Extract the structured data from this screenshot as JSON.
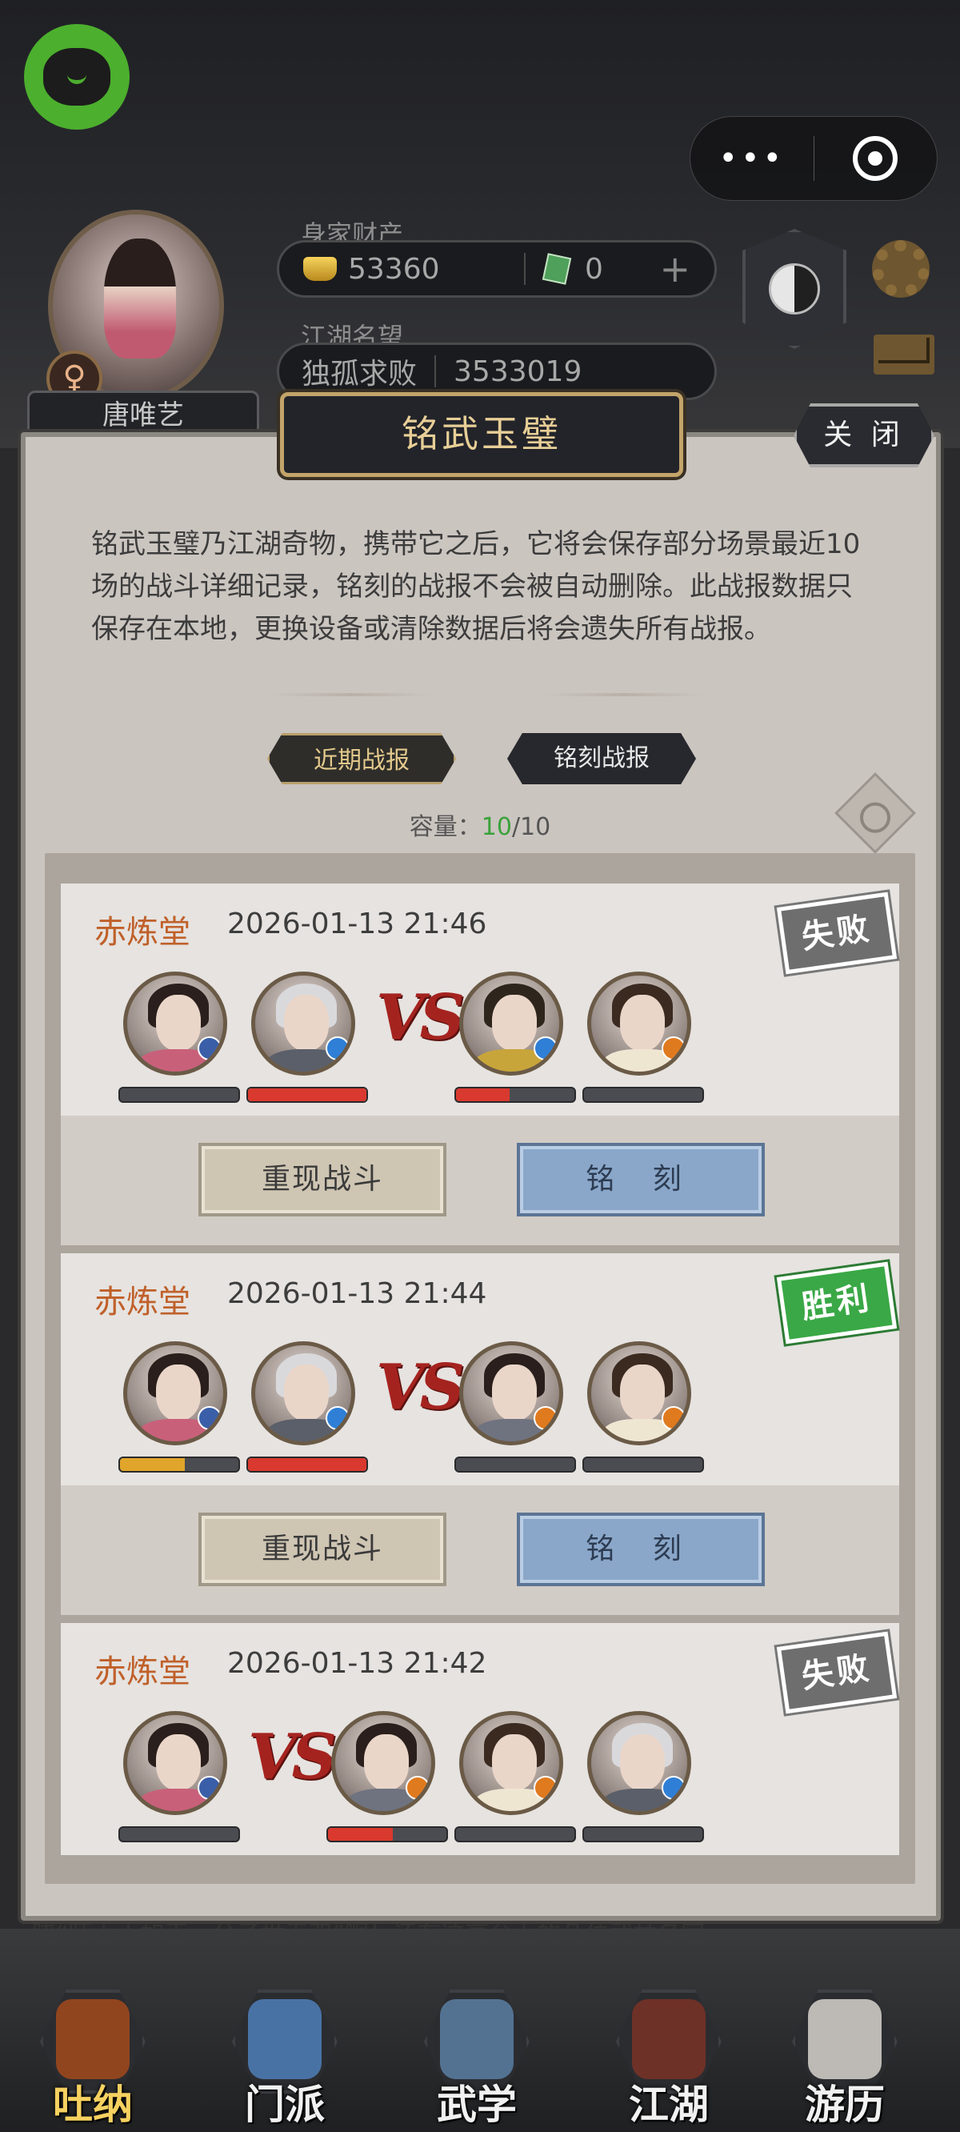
{
  "header": {
    "player_name": "唐唯艺",
    "gender_symbol": "♀",
    "wealth_label": "身家财产",
    "gold": "53360",
    "jade": "0",
    "plus": "+",
    "fame_label": "江湖名望",
    "fame_title": "独孤求败",
    "fame_value": "3533019",
    "badge_text": "-",
    "more_label": "•••"
  },
  "modal": {
    "title": "铭武玉璧",
    "close_label": "关 闭",
    "description": "铭武玉璧乃江湖奇物，携带它之后，它将会保存部分场景最近10场的战斗详细记录，铭刻的战报不会被自动删除。此战报数据只保存在本地，更换设备或清除数据后将会遗失所有战报。",
    "tabs": [
      {
        "label": "近期战报",
        "active": true
      },
      {
        "label": "铭刻战报",
        "active": false
      }
    ],
    "capacity_label": "容量：",
    "capacity_used": "10",
    "capacity_total": "/10"
  },
  "battles": [
    {
      "sect": "赤炼堂",
      "time": "2026-01-13 21:46",
      "result": "失败",
      "result_type": "lose",
      "vs": "VS",
      "replay_label": "重现战斗",
      "engrave_label": "铭 刻",
      "left_team": [
        {
          "name": "hero-a",
          "hair": "#2a1f1c",
          "cloth": "#c9607a",
          "elem": "#3a5fa8",
          "hp": 0.0,
          "hp_color": "#d9392e"
        },
        {
          "name": "hero-b",
          "hair": "#d9d9dc",
          "cloth": "#5a5f6a",
          "elem": "#2f7fd6",
          "hp": 1.0,
          "hp_color": "#d9392e"
        }
      ],
      "right_team": [
        {
          "name": "hero-c",
          "hair": "#2e261c",
          "cloth": "#c8a53a",
          "elem": "#2f7fd6",
          "hp": 0.45,
          "hp_color": "#d9392e"
        },
        {
          "name": "hero-d",
          "hair": "#3a2a20",
          "cloth": "#efe6d2",
          "elem": "#e07a1e",
          "hp": 0.0,
          "hp_color": "#d9392e"
        }
      ]
    },
    {
      "sect": "赤炼堂",
      "time": "2026-01-13 21:44",
      "result": "胜利",
      "result_type": "win",
      "vs": "VS",
      "replay_label": "重现战斗",
      "engrave_label": "铭 刻",
      "left_team": [
        {
          "name": "hero-a",
          "hair": "#2a1f1c",
          "cloth": "#c9607a",
          "elem": "#3a5fa8",
          "hp": 0.55,
          "hp_color": "#e0a52a"
        },
        {
          "name": "hero-b",
          "hair": "#d9d9dc",
          "cloth": "#5a5f6a",
          "elem": "#2f7fd6",
          "hp": 1.0,
          "hp_color": "#d9392e"
        }
      ],
      "right_team": [
        {
          "name": "hero-e",
          "hair": "#2a1f1c",
          "cloth": "#6f7380",
          "elem": "#e07a1e",
          "hp": 0.0,
          "hp_color": "#d9392e"
        },
        {
          "name": "hero-d",
          "hair": "#3a2a20",
          "cloth": "#efe6d2",
          "elem": "#e07a1e",
          "hp": 0.0,
          "hp_color": "#d9392e"
        }
      ]
    },
    {
      "sect": "赤炼堂",
      "time": "2026-01-13 21:42",
      "result": "失败",
      "result_type": "lose",
      "vs": "VS",
      "left_team": [
        {
          "name": "hero-a",
          "hair": "#2a1f1c",
          "cloth": "#c9607a",
          "elem": "#3a5fa8",
          "hp": 0.0,
          "hp_color": "#d9392e"
        }
      ],
      "right_team": [
        {
          "name": "hero-e",
          "hair": "#2a1f1c",
          "cloth": "#6f7380",
          "elem": "#e07a1e",
          "hp": 0.55,
          "hp_color": "#d9392e"
        },
        {
          "name": "hero-d",
          "hair": "#3a2a20",
          "cloth": "#efe6d2",
          "elem": "#e07a1e",
          "hp": 0.0,
          "hp_color": "#d9392e"
        },
        {
          "name": "hero-b",
          "hair": "#d9d9dc",
          "cloth": "#5a5f6a",
          "elem": "#2f7fd6",
          "hp": 0.0,
          "hp_color": "#d9392e"
        }
      ]
    }
  ],
  "story_text": "晓“陌上人如玉，公子世无双”啊！还有这高台上的几位武林名宿",
  "bottom_nav": [
    {
      "label": "吐纳",
      "icon": "gourd-icon",
      "active": true,
      "color": "#a34a1c"
    },
    {
      "label": "门派",
      "icon": "banner-icon",
      "active": false,
      "color": "#4f7fb8"
    },
    {
      "label": "武学",
      "icon": "scroll-icon",
      "active": false,
      "color": "#5a7fa3"
    },
    {
      "label": "江湖",
      "icon": "bamboo-hat-icon",
      "active": false,
      "color": "#7a3226"
    },
    {
      "label": "游历",
      "icon": "horse-icon",
      "active": false,
      "color": "#d7d2cc"
    }
  ]
}
